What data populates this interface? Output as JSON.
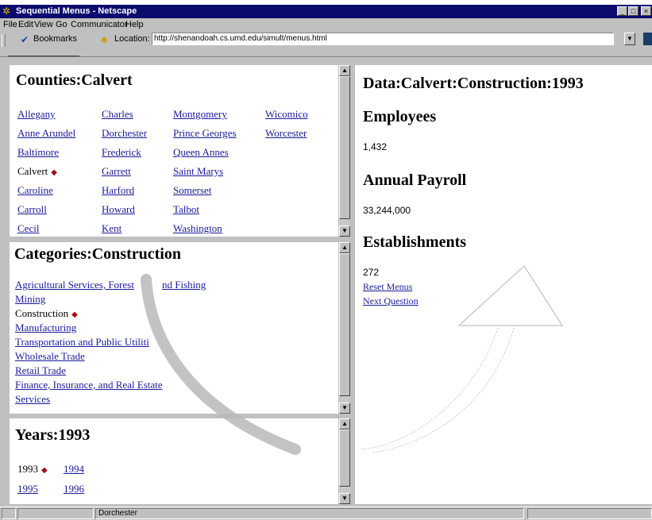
{
  "window": {
    "title": "Sequential Menus - Netscape",
    "controls": [
      "minimize",
      "maximize",
      "close"
    ]
  },
  "menubar": {
    "items": [
      "File",
      "Edit",
      "View",
      "Go",
      "Communicator",
      "Help"
    ]
  },
  "toolbar": {
    "bookmarks_label": "Bookmarks",
    "location_label": "Location:",
    "url": "http://shenandoah.cs.umd.edu/simult/menus.html"
  },
  "counties": {
    "heading": "Counties:Calvert",
    "col1": [
      "Allegany",
      "Anne Arundel",
      "Baltimore",
      "Calvert",
      "Caroline",
      "Carroll",
      "Cecil"
    ],
    "col2": [
      "Charles",
      "Dorchester",
      "Frederick",
      "Garrett",
      "Harford",
      "Howard",
      "Kent"
    ],
    "col3": [
      "Montgomery",
      "Prince Georges",
      "Queen Annes",
      "Saint Marys",
      "Somerset",
      "Talbot",
      "Washington"
    ],
    "col4": [
      "Wicomico",
      "Worcester"
    ],
    "selected": "Calvert"
  },
  "categories": {
    "heading": "Categories:Construction",
    "items": [
      "Agricultural Services, Forest",
      "nd Fishing",
      "Mining",
      "Construction",
      "Manufacturing",
      "Transportation and Public Utiliti",
      "Wholesale Trade",
      "Retail Trade",
      "Finance, Insurance, and Real Estate",
      "Services"
    ],
    "selected": "Construction"
  },
  "years": {
    "heading": "Years:1993",
    "items": [
      "1993",
      "1994",
      "1995",
      "1996"
    ],
    "selected": "1993"
  },
  "data": {
    "heading": "Data:Calvert:Construction:1993",
    "employees_label": "Employees",
    "employees_value": "1,432",
    "payroll_label": "Annual Payroll",
    "payroll_value": "33,244,000",
    "establishments_label": "Establishments",
    "establishments_value": "272",
    "reset_link": "Reset Menus",
    "next_link": "Next Question"
  },
  "statusbar": {
    "text": "Dorchester"
  },
  "colors": {
    "titlebar": "#0b0b6e",
    "link": "#1a1a9a",
    "selected_marker": "#a01010",
    "chrome": "#c0c0c0"
  }
}
